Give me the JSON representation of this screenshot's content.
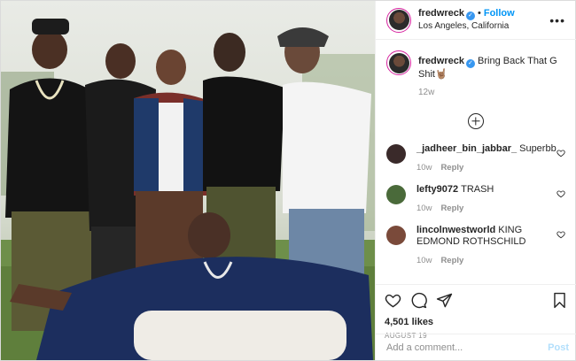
{
  "post": {
    "username": "fredwreck",
    "verified_icon": "verified-badge-icon",
    "follow_label": "Follow",
    "separator": "•",
    "location": "Los Angeles, California",
    "more_icon": "more-options-icon",
    "more_glyph": "•••"
  },
  "caption": {
    "username": "fredwreck",
    "text": "Bring Back That G Shit🤘🏽",
    "age": "12w"
  },
  "load_more_icon": "plus-circle-icon",
  "comments": [
    {
      "username": "_jadheer_bin_jabbar_",
      "text": "Superbb",
      "age": "10w",
      "reply_label": "Reply",
      "avatar_color": "#3a2a2a"
    },
    {
      "username": "lefty9072",
      "text": "TRASH",
      "age": "10w",
      "reply_label": "Reply",
      "avatar_color": "#4a6a3a"
    },
    {
      "username": "lincolnwestworld",
      "text": "KING EDMOND ROTHSCHILD",
      "age": "10w",
      "reply_label": "Reply",
      "avatar_color": "#7a4a3a"
    }
  ],
  "actions": {
    "like_icon": "heart-icon",
    "comment_icon": "comment-icon",
    "share_icon": "share-icon",
    "save_icon": "bookmark-icon",
    "likes_text": "4,501 likes",
    "date_text": "AUGUST 19"
  },
  "add_comment": {
    "placeholder": "Add a comment...",
    "post_label": "Post"
  },
  "colors": {
    "accent": "#0095f6",
    "verified": "#3897f0",
    "post_disabled": "#b2dffc",
    "meta": "#8e8e8e"
  }
}
